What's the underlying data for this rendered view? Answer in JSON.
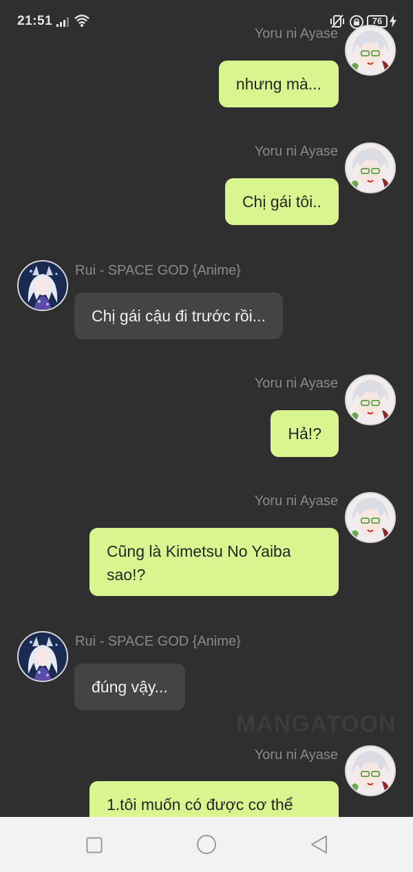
{
  "status_bar": {
    "time": "21:51",
    "battery": "76"
  },
  "messages": [
    {
      "sender": "Yoru ni Ayase",
      "side": "sent",
      "text": "nhưng mà..."
    },
    {
      "sender": "Yoru ni Ayase",
      "side": "sent",
      "text": "Chị gái tôi.."
    },
    {
      "sender": "Rui - SPACE GOD {Anime}",
      "side": "recv",
      "text": "Chị gái cậu đi trước rồi..."
    },
    {
      "sender": "Yoru ni Ayase",
      "side": "sent",
      "text": "Hả!?"
    },
    {
      "sender": "Yoru ni Ayase",
      "side": "sent",
      "text": "Cũng là Kimetsu No Yaiba sao!?"
    },
    {
      "sender": "Rui - SPACE GOD {Anime}",
      "side": "recv",
      "text": "đúng vậy..."
    },
    {
      "sender": "Yoru ni Ayase",
      "side": "sent",
      "text": "1.tôi muốn có được cơ thể"
    }
  ],
  "watermark": "MANGATOON",
  "colors": {
    "background": "#2f2f2f",
    "sent_bubble": "#d8f58f",
    "received_bubble": "#444444",
    "sender_name": "#8a8a8a",
    "nav_bar": "#f2f2f2"
  },
  "icons": {
    "status": [
      "signal-icon",
      "wifi-icon",
      "vibrate-off-icon",
      "lock-rotation-icon",
      "battery-icon",
      "charging-bolt-icon"
    ],
    "navigation": [
      "recent-apps-icon",
      "home-icon",
      "back-icon"
    ]
  }
}
